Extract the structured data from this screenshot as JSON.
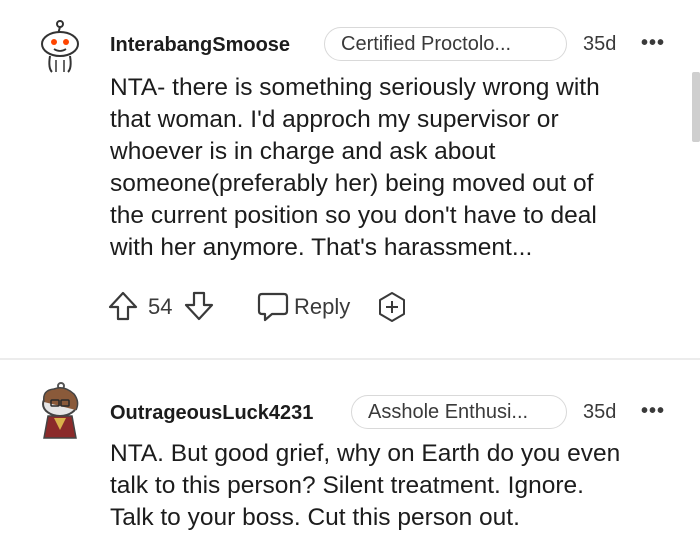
{
  "comments": [
    {
      "username": "InterabangSmoose",
      "flair": "Certified Proctolo...",
      "age": "35d",
      "body": "NTA- there is something seriously wrong with\nthat woman. I'd approch my supervisor or\nwhoever is in charge and ask about\nsomeone(preferably her) being moved out of\nthe current position so you don't have to deal\nwith her anymore. That's harassment...",
      "votes": "54",
      "reply_label": "Reply",
      "avatar_icon": "snoo-avatar-icon"
    },
    {
      "username": "OutrageousLuck4231",
      "flair": "Asshole Enthusi...",
      "age": "35d",
      "body": "NTA. But good grief, why on Earth do you even\ntalk to this person? Silent treatment. Ignore.\nTalk to your boss. Cut this person out.",
      "avatar_icon": "custom-avatar-icon"
    }
  ],
  "more_label": "•••",
  "colors": {
    "text": "#1c1c1c",
    "muted": "#3a3a3a",
    "border": "#d9d9d9",
    "snoo_eye": "#ff4500"
  }
}
